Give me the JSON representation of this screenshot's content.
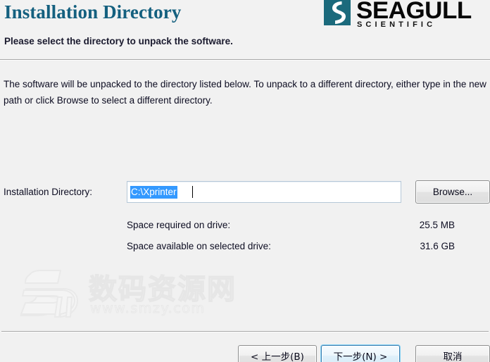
{
  "header": {
    "title": "Installation Directory",
    "subtitle": "Please select the directory to unpack the software.",
    "logo": {
      "mark_icon": "seagull-s-mark-icon",
      "wordmark": "SEAGULL",
      "tagline": "SCIENTIFIC",
      "mark_color": "#1b6a7c"
    }
  },
  "main": {
    "intro_text": "The software will be unpacked to the directory listed below.  To unpack to a different directory, either type in the new path or click Browse to select a different directory.",
    "directory": {
      "label": "Installation Directory:",
      "value": "C:\\Xprinter",
      "placeholder": "",
      "selected": true,
      "selection_color": "#3399ff",
      "browse_label": "Browse..."
    },
    "space": [
      {
        "label": "Space required on drive:",
        "value": "25.5 MB"
      },
      {
        "label": "Space available on selected drive:",
        "value": "31.6 GB"
      }
    ]
  },
  "watermark": {
    "mark_icon": "smzy-logo-icon",
    "text": "数码资源网",
    "url": "www.smzy.com"
  },
  "footer": {
    "back_label": "< 上一步(B)",
    "next_label": "下一步(N) >",
    "cancel_label": "取消",
    "default_button": "next",
    "focus_color": "#8ad4f5"
  }
}
